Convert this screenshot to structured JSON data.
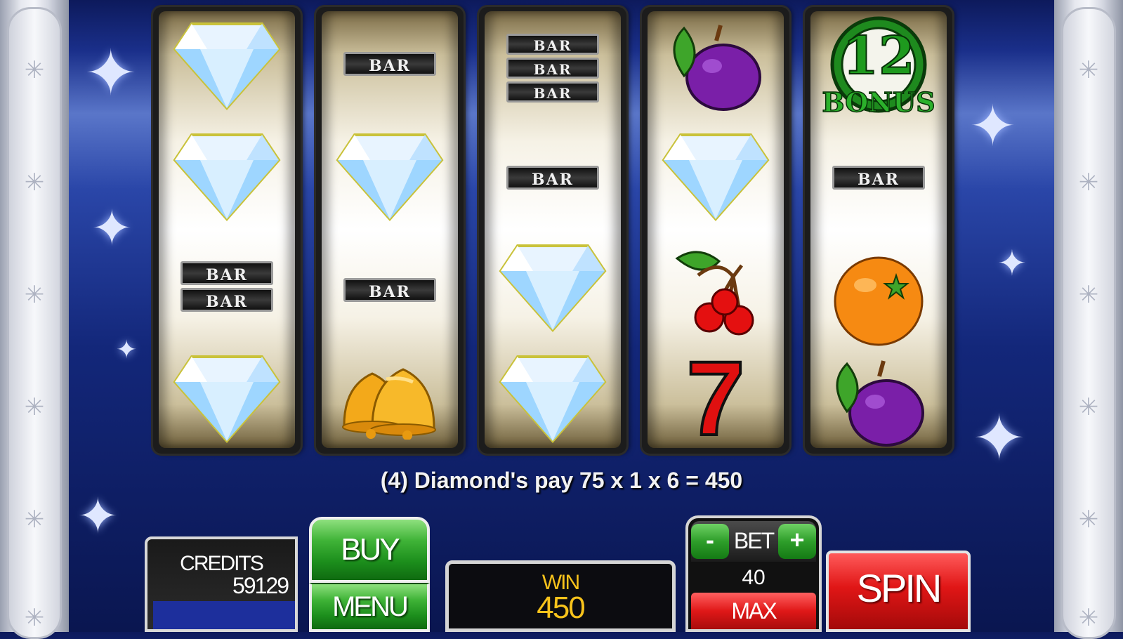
{
  "game": {
    "reels": [
      {
        "symbols": [
          "diamond-icon",
          "diamond-icon",
          "double-bar",
          "diamond-icon"
        ]
      },
      {
        "symbols": [
          "bar",
          "diamond-icon",
          "bar",
          "bells-icon"
        ]
      },
      {
        "symbols": [
          "triple-bar",
          "bar",
          "diamond-icon",
          "diamond-icon"
        ]
      },
      {
        "symbols": [
          "plum-icon",
          "diamond-icon",
          "cherries-icon",
          "seven-icon"
        ]
      },
      {
        "symbols": [
          "bonus-12-icon",
          "bar",
          "orange-icon",
          "plum-icon"
        ]
      }
    ],
    "bar_text": "BAR",
    "bonus": {
      "number": "12",
      "label": "BONUS"
    },
    "seven_text": "7",
    "message": "(4) Diamond's pay 75 x 1 x 6 = 450"
  },
  "controls": {
    "credits_label": "CREDITS",
    "credits_value": "59129",
    "buy_label": "BUY",
    "menu_label": "MENU",
    "win_label": "WIN",
    "win_value": "450",
    "bet_minus": "-",
    "bet_label": "BET",
    "bet_plus": "+",
    "bet_value": "40",
    "max_label": "MAX",
    "spin_label": "SPIN"
  },
  "colors": {
    "win_text": "#f7c21b",
    "spin_red": "#e01616",
    "button_green": "#3fb337"
  }
}
